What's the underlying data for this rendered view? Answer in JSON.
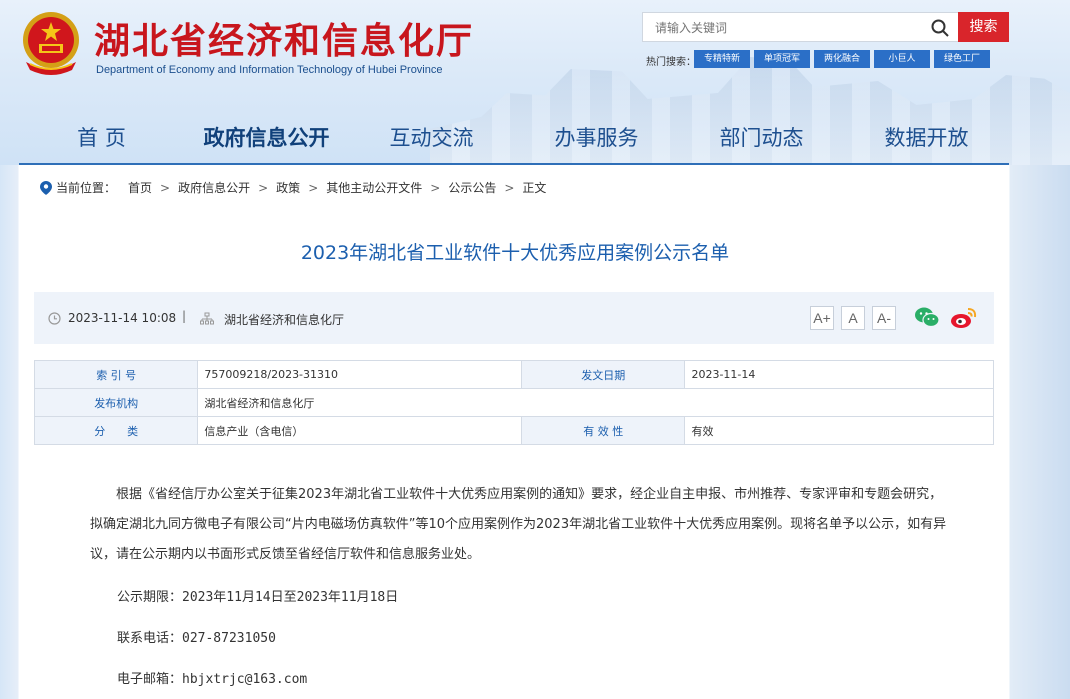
{
  "header": {
    "site_title": "湖北省经济和信息化厅",
    "site_subtitle": "Department of Economy and Information Technology of Hubei Province",
    "search_placeholder": "请输入关键词",
    "search_button": "搜索",
    "hot_label": "热门搜索：",
    "hot_tags": [
      "专精特新",
      "单项冠军",
      "两化融合",
      "小巨人",
      "绿色工厂"
    ]
  },
  "nav": {
    "items": [
      "首 页",
      "政府信息公开",
      "互动交流",
      "办事服务",
      "部门动态",
      "数据开放"
    ],
    "active_index": 1
  },
  "breadcrumb": {
    "label": "当前位置：",
    "items": [
      "首页",
      "政府信息公开",
      "政策",
      "其他主动公开文件",
      "公示公告",
      "正文"
    ],
    "separator": ">"
  },
  "article": {
    "title": "2023年湖北省工业软件十大优秀应用案例公示名单",
    "date": "2023-11-14 10:08",
    "meta_separator": "|",
    "source": "湖北省经济和信息化厅",
    "font_sizes": [
      "A+",
      "A",
      "A-"
    ],
    "info": {
      "index_label": "索 引 号",
      "index_value": "757009218/2023-31310",
      "date_label": "发文日期",
      "date_value": "2023-11-14",
      "org_label": "发布机构",
      "org_value": "湖北省经济和信息化厅",
      "category_label": "分　　类",
      "category_value": "信息产业（含电信）",
      "validity_label": "有 效 性",
      "validity_value": "有效"
    },
    "body": "根据《省经信厅办公室关于征集2023年湖北省工业软件十大优秀应用案例的通知》要求，经企业自主申报、市州推荐、专家评审和专题会研究，拟确定湖北九同方微电子有限公司“片内电磁场仿真软件”等10个应用案例作为2023年湖北省工业软件十大优秀应用案例。现将名单予以公示，如有异议，请在公示期内以书面形式反馈至省经信厅软件和信息服务业处。",
    "period": "公示期限：2023年11月14日至2023年11月18日",
    "phone": "联系电话：027-87231050",
    "email": "电子邮箱：hbjxtrjc@163.com"
  },
  "colors": {
    "brand_red": "#c8161d",
    "nav_blue": "#1d4f8f",
    "title_blue": "#1c5fae",
    "tag_blue": "#2b6fc7"
  }
}
